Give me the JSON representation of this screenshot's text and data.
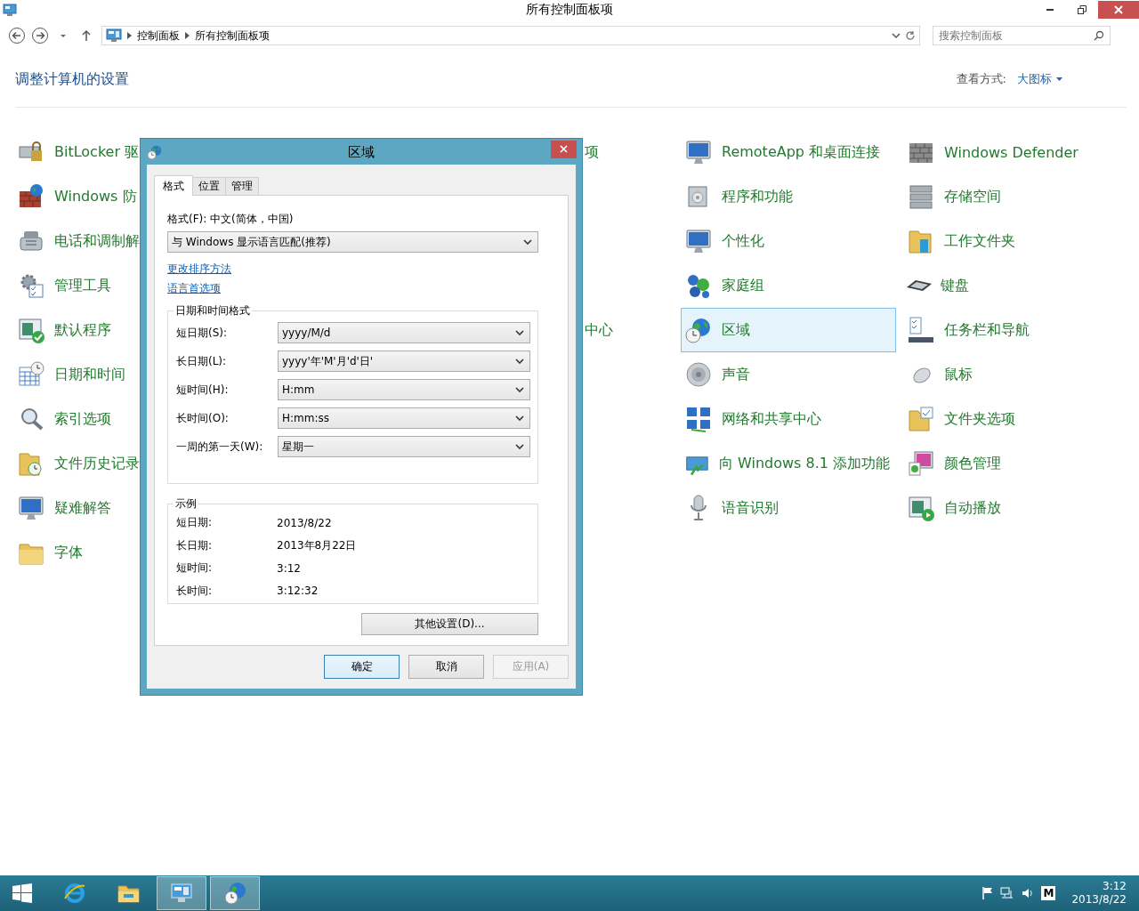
{
  "window": {
    "title": "所有控制面板项"
  },
  "address_bar": {
    "breadcrumbs": [
      "控制面板",
      "所有控制面板项"
    ]
  },
  "search": {
    "placeholder": "搜索控制面板"
  },
  "header": {
    "title": "调整计算机的设置",
    "view_label": "查看方式:",
    "view_value": "大图标"
  },
  "columns": [
    {
      "items": [
        {
          "label": "BitLocker 驱",
          "selected": false
        },
        {
          "label": "Windows 防",
          "selected": false
        },
        {
          "label": "电话和调制解",
          "selected": false
        },
        {
          "label": "管理工具",
          "selected": false
        },
        {
          "label": "默认程序",
          "selected": false
        },
        {
          "label": "日期和时间",
          "selected": false
        },
        {
          "label": "索引选项",
          "selected": false
        },
        {
          "label": "文件历史记录",
          "selected": false
        },
        {
          "label": "疑难解答",
          "selected": false
        },
        {
          "label": "字体",
          "selected": false
        }
      ]
    },
    {
      "items": [
        {
          "label": "项"
        },
        {
          "label": "中心"
        }
      ]
    },
    {
      "items": [
        {
          "label": "RemoteApp 和桌面连接",
          "selected": false
        },
        {
          "label": "程序和功能",
          "selected": false
        },
        {
          "label": "个性化",
          "selected": false
        },
        {
          "label": "家庭组",
          "selected": false
        },
        {
          "label": "区域",
          "selected": true
        },
        {
          "label": "声音",
          "selected": false
        },
        {
          "label": "网络和共享中心",
          "selected": false
        },
        {
          "label": "向 Windows 8.1 添加功能",
          "selected": false
        },
        {
          "label": "语音识别",
          "selected": false
        }
      ]
    },
    {
      "items": [
        {
          "label": "Windows Defender",
          "selected": false
        },
        {
          "label": "存储空间",
          "selected": false
        },
        {
          "label": "工作文件夹",
          "selected": false
        },
        {
          "label": "键盘",
          "selected": false
        },
        {
          "label": "任务栏和导航",
          "selected": false
        },
        {
          "label": "鼠标",
          "selected": false
        },
        {
          "label": "文件夹选项",
          "selected": false
        },
        {
          "label": "颜色管理",
          "selected": false
        },
        {
          "label": "自动播放",
          "selected": false
        }
      ]
    }
  ],
  "dialog": {
    "title": "区域",
    "tabs": [
      {
        "label": "格式",
        "selected": true
      },
      {
        "label": "位置",
        "selected": false
      },
      {
        "label": "管理",
        "selected": false
      }
    ],
    "format_label": "格式(F): 中文(简体，中国)",
    "format_select": "与 Windows 显示语言匹配(推荐)",
    "links": [
      "更改排序方法",
      "语言首选项"
    ],
    "datetime_group": {
      "title": "日期和时间格式",
      "rows": [
        {
          "label": "短日期(S):",
          "value": "yyyy/M/d"
        },
        {
          "label": "长日期(L):",
          "value": "yyyy'年'M'月'd'日'"
        },
        {
          "label": "短时间(H):",
          "value": "H:mm"
        },
        {
          "label": "长时间(O):",
          "value": "H:mm:ss"
        },
        {
          "label": "一周的第一天(W):",
          "value": "星期一"
        }
      ]
    },
    "examples": {
      "title": "示例",
      "rows": [
        {
          "label": "短日期:",
          "value": "2013/8/22"
        },
        {
          "label": "长日期:",
          "value": "2013年8月22日"
        },
        {
          "label": "短时间:",
          "value": "3:12"
        },
        {
          "label": "长时间:",
          "value": "3:12:32"
        }
      ]
    },
    "more_button": "其他设置(D)...",
    "buttons": [
      {
        "label": "确定",
        "kind": "default",
        "disabled": false
      },
      {
        "label": "取消",
        "kind": "normal",
        "disabled": false
      },
      {
        "label": "应用(A)",
        "kind": "normal",
        "disabled": true
      }
    ]
  },
  "taskbar": {
    "apps": [
      {
        "selected": false
      },
      {
        "selected": false
      },
      {
        "selected": true
      },
      {
        "selected": true
      }
    ],
    "ime": "M",
    "time": "3:12",
    "date": "2013/8/22"
  }
}
